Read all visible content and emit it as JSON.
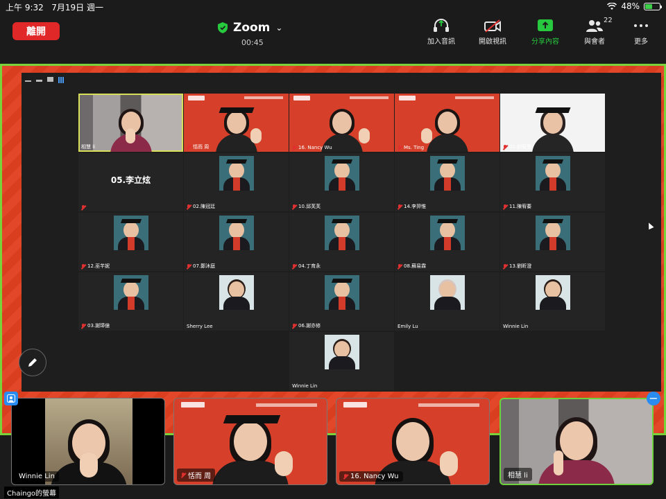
{
  "status_bar": {
    "time": "上午 9:32",
    "date": "7月19日 週一",
    "battery": "48%",
    "battery_level": 0.48
  },
  "zoom": {
    "leave_label": "離開",
    "app_name": "Zoom",
    "timer": "00:45",
    "toolbar": [
      {
        "label": "加入音訊",
        "icon": "headphones-icon"
      },
      {
        "label": "開啟視訊",
        "icon": "video-off-icon"
      },
      {
        "label": "分享內容",
        "icon": "share-screen-icon"
      },
      {
        "label": "與會者",
        "icon": "participants-icon",
        "count": "22"
      },
      {
        "label": "更多",
        "icon": "more-icon"
      }
    ]
  },
  "gallery": [
    {
      "name": "相慧 li",
      "type": "room",
      "active": true
    },
    {
      "name": "恬而 周",
      "type": "grad"
    },
    {
      "name": "16. Nancy Wu",
      "type": "wave"
    },
    {
      "name": "Ms. Ting",
      "type": "wave2"
    },
    {
      "name": "01.劉宥恩",
      "type": "kid"
    },
    {
      "name": "",
      "type": "text",
      "big": "05.李立炫"
    },
    {
      "name": "02.陳冠廷",
      "type": "photo"
    },
    {
      "name": "10.邱芙芙",
      "type": "photo"
    },
    {
      "name": "14.李羿惟",
      "type": "photo"
    },
    {
      "name": "11.陳宥蓁",
      "type": "photo"
    },
    {
      "name": "12.巫芊妮",
      "type": "photo"
    },
    {
      "name": "07.鄭沐庭",
      "type": "photo"
    },
    {
      "name": "04.丁育永",
      "type": "photo"
    },
    {
      "name": "08.蘇易霖",
      "type": "photo"
    },
    {
      "name": "13.劉昕澄",
      "type": "photo"
    },
    {
      "name": "03.謝璋億",
      "type": "photo"
    },
    {
      "name": "Sherry Lee",
      "type": "photo-light"
    },
    {
      "name": "06.謝亦修",
      "type": "photo"
    },
    {
      "name": "Emily Lu",
      "type": "photo-blonde"
    },
    {
      "name": "Winnie Lin",
      "type": "photo-light"
    },
    {
      "name": "Winnie Lin",
      "type": "photo-light"
    }
  ],
  "filmstrip": [
    {
      "name": "Winnie Lin",
      "type": "winnie"
    },
    {
      "name": "恬而 周",
      "type": "grad"
    },
    {
      "name": "16. Nancy Wu",
      "type": "wave"
    },
    {
      "name": "相慧 li",
      "type": "room"
    }
  ],
  "screen_label": "Chaingo的螢幕",
  "colors": {
    "leave": "#e02828",
    "share_accent": "#27c93f",
    "banner_red": "#d6402a",
    "active_border": "#d8e05a",
    "frame_border": "#7bd33c",
    "pin_blue": "#2a8cf0"
  }
}
